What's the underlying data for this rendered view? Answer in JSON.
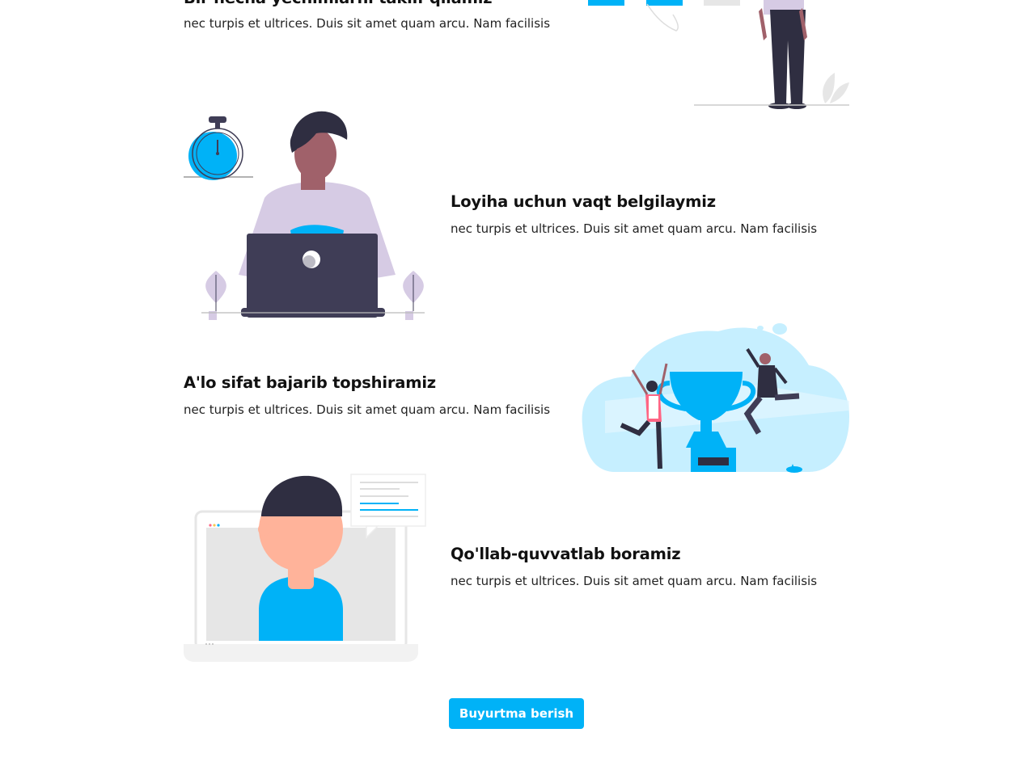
{
  "features": [
    {
      "title": "Bir necha yechimlarni taklif qilamiz",
      "text": "nec turpis et ultrices. Duis sit amet quam arcu. Nam facilisis"
    },
    {
      "title": "Loyiha uchun vaqt belgilaymiz",
      "text": "nec turpis et ultrices. Duis sit amet quam arcu. Nam facilisis"
    },
    {
      "title": "A'lo sifat bajarib topshiramiz",
      "text": "nec turpis et ultrices. Duis sit amet quam arcu. Nam facilisis"
    },
    {
      "title": "Qo'llab-quvvatlab boramiz",
      "text": "nec turpis et ultrices. Duis sit amet quam arcu. Nam facilisis"
    }
  ],
  "cta": {
    "label": "Buyurtma berish"
  },
  "colors": {
    "accent": "#00b2f7",
    "dark": "#3f3d56",
    "lavender": "#d6cbe4",
    "skin": "#a0616a"
  }
}
